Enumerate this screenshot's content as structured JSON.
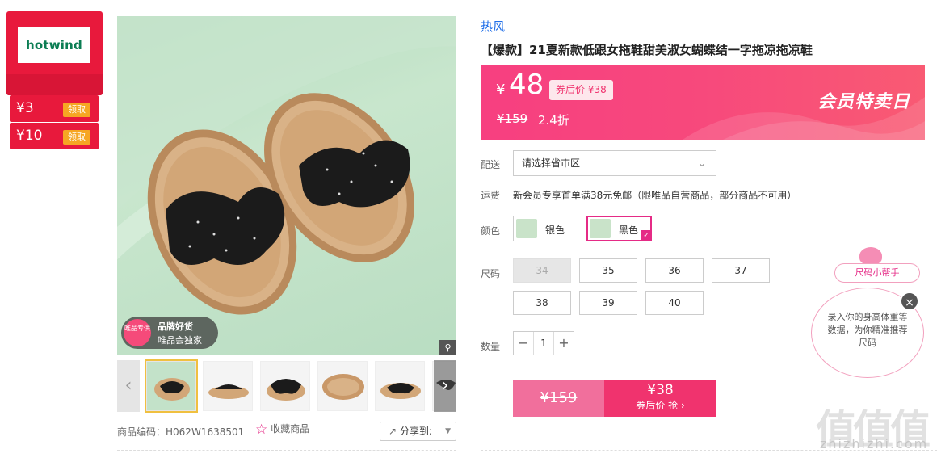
{
  "brand": {
    "logo_text": "hotwind",
    "coupons": [
      {
        "amount": "¥3",
        "action": "领取"
      },
      {
        "amount": "¥10",
        "action": "领取"
      }
    ]
  },
  "gallery": {
    "badge_line1": "品牌好货",
    "badge_line2": "唯品会独家",
    "badge_icon_text": "唯品专供",
    "zoom_icon": "magnifier-icon",
    "prev_icon": "chevron-left-icon",
    "next_icon": "chevron-right-icon",
    "thumb_count": 6
  },
  "meta": {
    "product_code_label": "商品编码：",
    "product_code": "H062W1638501",
    "favorite_label": "收藏商品",
    "share_label": "分享到:"
  },
  "product": {
    "brand_link": "热风",
    "title": "【爆款】21夏新款低跟女拖鞋甜美淑女蝴蝶结一字拖凉拖凉鞋"
  },
  "price": {
    "currency": "¥",
    "current": "48",
    "after_coupon_label": "券后价 ¥38",
    "original": "¥159",
    "discount": "2.4折",
    "promo_banner": "会员特卖日"
  },
  "options": {
    "delivery_label": "配送",
    "delivery_placeholder": "请选择省市区",
    "shipping_label": "运费",
    "shipping_text": "新会员专享首单满38元免邮（限唯品自营商品，部分商品不可用）",
    "color_label": "颜色",
    "colors": [
      {
        "name": "银色",
        "selected": false
      },
      {
        "name": "黑色",
        "selected": true
      }
    ],
    "size_label": "尺码",
    "sizes": [
      {
        "value": "34",
        "available": false
      },
      {
        "value": "35",
        "available": true
      },
      {
        "value": "36",
        "available": true
      },
      {
        "value": "37",
        "available": true
      },
      {
        "value": "38",
        "available": true
      },
      {
        "value": "39",
        "available": true
      },
      {
        "value": "40",
        "available": true
      }
    ],
    "qty_label": "数量",
    "qty_value": "1",
    "qty_minus": "−",
    "qty_plus": "+"
  },
  "buy": {
    "original_price": "¥159",
    "coupon_price": "¥38",
    "coupon_action": "券后价 抢 ›"
  },
  "size_helper": {
    "label": "尺码小帮手",
    "text": "录入你的身高体重等数据，为你精准推荐尺码",
    "close": "×"
  },
  "watermark": {
    "text": "值值值",
    "url": "zhizhizhi.com"
  },
  "colors": {
    "brand_red": "#e8193c",
    "price_pink": "#f73f80",
    "accent_pink": "#e52b86",
    "coupon_orange": "#f6a623",
    "link_blue": "#1f6ee8"
  }
}
